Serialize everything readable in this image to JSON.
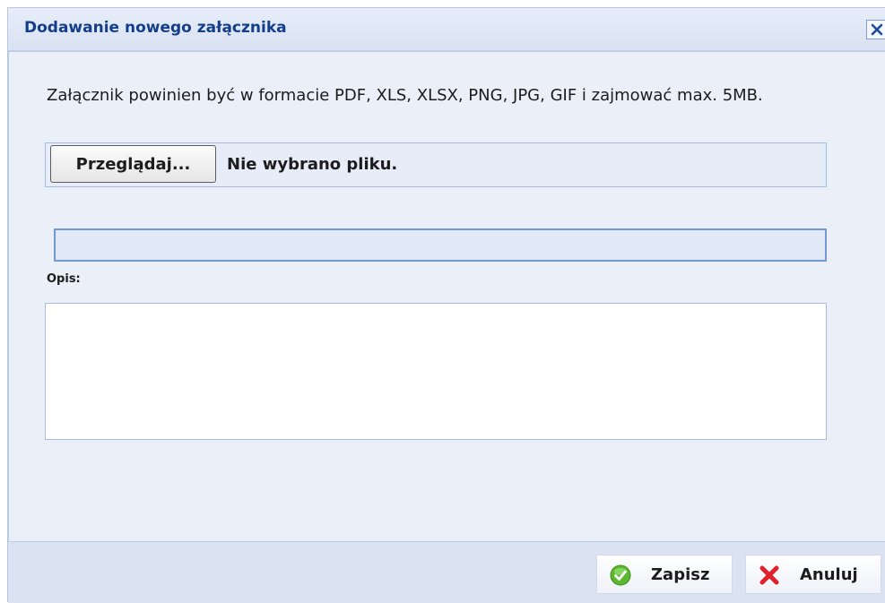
{
  "dialog": {
    "title": "Dodawanie nowego załącznika",
    "close_icon": "close-icon"
  },
  "form": {
    "info_text": "Załącznik powinien być w formacie PDF, XLS, XLSX, PNG, JPG, GIF i zajmować max. 5MB.",
    "browse_label": "Przeglądaj...",
    "file_status": "Nie wybrano pliku.",
    "name_value": "",
    "description_label": "Opis:",
    "description_value": ""
  },
  "footer": {
    "save_label": "Zapisz",
    "save_icon": "check-icon",
    "cancel_label": "Anuluj",
    "cancel_icon": "cross-icon"
  },
  "colors": {
    "title_text": "#153e8a",
    "save_icon": "#5cb82e",
    "cancel_icon": "#e0202a"
  }
}
